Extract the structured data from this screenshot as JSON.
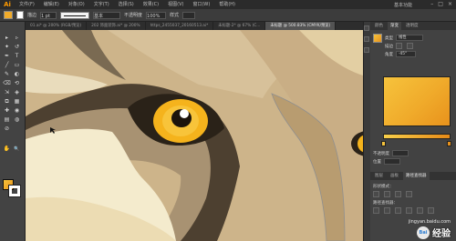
{
  "app": {
    "logo": "Ai"
  },
  "menubar": {
    "items": [
      "文件(F)",
      "编辑(E)",
      "对象(O)",
      "文字(T)",
      "选择(S)",
      "效果(C)",
      "视图(V)",
      "窗口(W)",
      "帮助(H)"
    ],
    "workspace": "基本功能",
    "window_controls": [
      "–",
      "□",
      "×"
    ]
  },
  "controlbar": {
    "fill_color": "#f0ab2b",
    "stroke_label": "描边",
    "stroke_value": "1 pt",
    "profile_label": "基本",
    "opacity_label": "不透明度",
    "opacity_value": "100%",
    "style_label": "样式"
  },
  "tabs": [
    {
      "label": "01.ai* @ 200% (RGB/预览)",
      "active": false
    },
    {
      "label": "202 饰面装饰.ai* @ 200%",
      "active": false
    },
    {
      "label": "https_2455037_20160513.ai*",
      "active": false
    },
    {
      "label": "未标题-2* @ 67% (C...",
      "active": false
    },
    {
      "label": "未标题 @ 500.83% (CMYK/预览)",
      "active": true
    }
  ],
  "toolbox": {
    "tools": [
      "▸",
      "▹",
      "✦",
      "↺",
      "✒",
      "T",
      "╱",
      "▭",
      "✎",
      "◐",
      "⌫",
      "⟲",
      "⇲",
      "◈",
      "⧉",
      "▦",
      "✚",
      "◉",
      "▤",
      "◍",
      "⊘",
      "✋",
      "🔍"
    ],
    "fill_color": "#f0ab2b",
    "stroke_color": "#ffffff"
  },
  "panel": {
    "tabs": [
      "颜色",
      "渐变",
      "透明度"
    ],
    "type_label": "类型",
    "type_value": "线性",
    "stroke_label": "描边",
    "angle_label": "角度",
    "angle_value": "-45°",
    "opacity_label": "不透明度",
    "location_label": "位置",
    "layers_tabs": [
      "图层",
      "画板",
      "路径查找器"
    ],
    "shape_mode_label": "形状模式：",
    "pathfinder_label": "路径查找器：",
    "gradient_colors": [
      "#f6c33c",
      "#f0ab2b",
      "#e8921c"
    ]
  },
  "watermark": {
    "brand": "Bai",
    "text": "经验",
    "url": "jingyan.baidu.com"
  },
  "colors": {
    "fur_light": "#f6eed3",
    "fur_mid": "#d8b98a",
    "fur_dark": "#5a4a35",
    "iris": "#f5b31c",
    "canvas_bg": "#d9c59d"
  }
}
